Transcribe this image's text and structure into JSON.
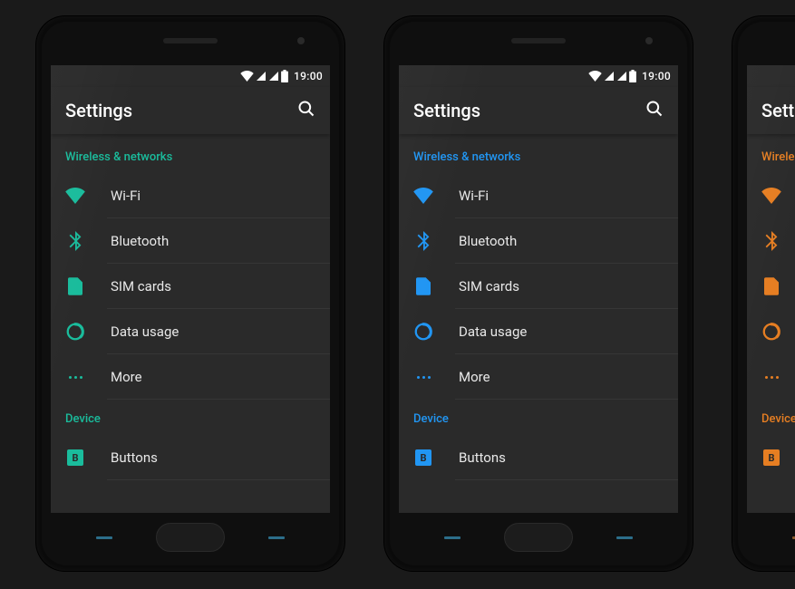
{
  "phones": [
    {
      "accent": "#1abc9c",
      "nav_key_color": "#2c6e8a"
    },
    {
      "accent": "#2196f3",
      "nav_key_color": "#2c6e8a"
    },
    {
      "accent": "#e67e22",
      "nav_key_color": "#8a5a2c"
    }
  ],
  "status": {
    "time": "19:00"
  },
  "appbar": {
    "title": "Settings"
  },
  "sections": [
    {
      "header": "Wireless & networks",
      "items": [
        {
          "icon": "wifi-icon",
          "label": "Wi-Fi"
        },
        {
          "icon": "bluetooth-icon",
          "label": "Bluetooth"
        },
        {
          "icon": "sim-icon",
          "label": "SIM cards"
        },
        {
          "icon": "data-usage-icon",
          "label": "Data usage"
        },
        {
          "icon": "more-icon",
          "label": "More"
        }
      ]
    },
    {
      "header": "Device",
      "items": [
        {
          "icon": "buttons-icon",
          "label": "Buttons"
        }
      ]
    }
  ]
}
